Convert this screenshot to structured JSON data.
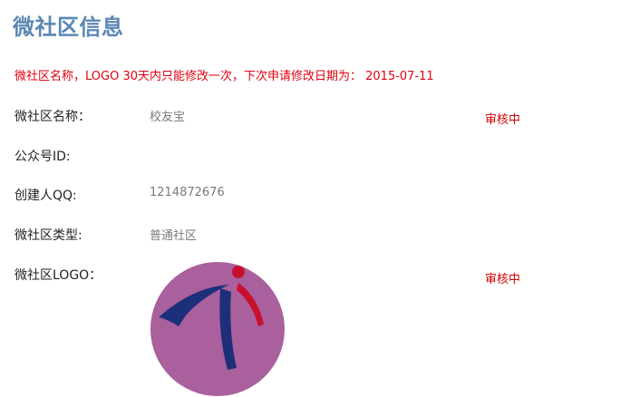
{
  "page": {
    "title": "微社区信息"
  },
  "notice": "微社区名称，LOGO 30天内只能修改一次，下次申请修改日期为： 2015-07-11",
  "fields": {
    "name": {
      "label": "微社区名称：",
      "value": "校友宝",
      "status": "审核中"
    },
    "public_id": {
      "label": "公众号ID:"
    },
    "creator_qq": {
      "label": "创建人QQ:",
      "value": "1214872676"
    },
    "type": {
      "label": "微社区类型:",
      "value": "普通社区"
    },
    "logo": {
      "label": "微社区LOGO：",
      "status": "审核中",
      "image": "community-logo-icon"
    }
  },
  "colors": {
    "title": "#5b87b3",
    "notice": "#e0000f",
    "status": "#d40000",
    "value": "#7a7a7a",
    "logo_bg": "#a9609c"
  }
}
